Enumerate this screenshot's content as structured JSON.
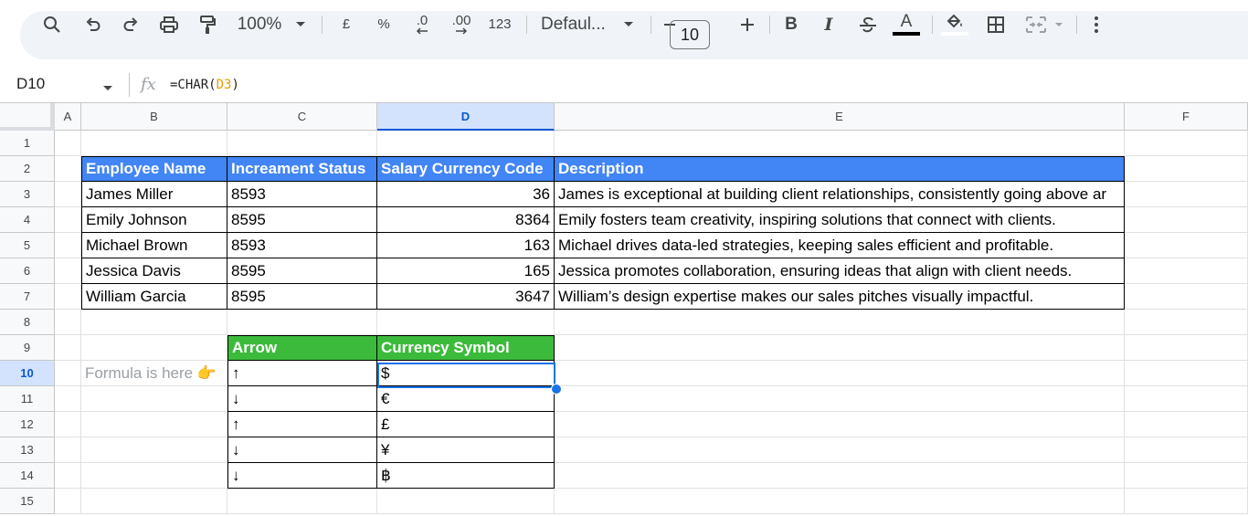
{
  "toolbar": {
    "zoom": "100%",
    "currency": "£",
    "percent": "%",
    "decrease_decimal": ".0",
    "increase_decimal": ".00",
    "more_formats": "123",
    "font": "Defaul...",
    "font_size": "10",
    "bold": "B",
    "italic": "I",
    "text_color_letter": "A"
  },
  "formula_bar": {
    "cell_ref": "D10",
    "fx": "fx",
    "formula_prefix": "=CHAR(",
    "formula_ref": "D3",
    "formula_suffix": ")"
  },
  "columns": [
    "A",
    "B",
    "C",
    "D",
    "E",
    "F"
  ],
  "rows": [
    "1",
    "2",
    "3",
    "4",
    "5",
    "6",
    "7",
    "8",
    "9",
    "10",
    "11",
    "12",
    "13",
    "14",
    "15"
  ],
  "selected_cell": "D10",
  "table1": {
    "headers": [
      "Employee Name",
      "Increament Status",
      "Salary Currency Code",
      "Description"
    ],
    "rows": [
      [
        "James Miller",
        "8593",
        "36",
        "James is exceptional at building client relationships, consistently going above ar"
      ],
      [
        "Emily Johnson",
        "8595",
        "8364",
        "Emily fosters team creativity, inspiring solutions that connect with clients."
      ],
      [
        "Michael Brown",
        "8593",
        "163",
        "Michael drives data-led strategies, keeping sales efficient and profitable."
      ],
      [
        "Jessica Davis",
        "8595",
        "165",
        "Jessica promotes collaboration, ensuring ideas that align with client needs."
      ],
      [
        "William Garcia",
        "8595",
        "3647",
        "William’s design expertise makes our sales pitches visually impactful."
      ]
    ]
  },
  "note": "Formula is here 👉",
  "table2": {
    "headers": [
      "Arrow",
      "Currency Symbol"
    ],
    "rows": [
      [
        "↑",
        "$"
      ],
      [
        "↓",
        "€"
      ],
      [
        "↑",
        "£"
      ],
      [
        "↓",
        "¥"
      ],
      [
        "↓",
        "฿"
      ]
    ]
  },
  "colors": {
    "header_blue": "#4285f4",
    "header_green": "#3cba3c",
    "selection": "#1a73e8"
  }
}
